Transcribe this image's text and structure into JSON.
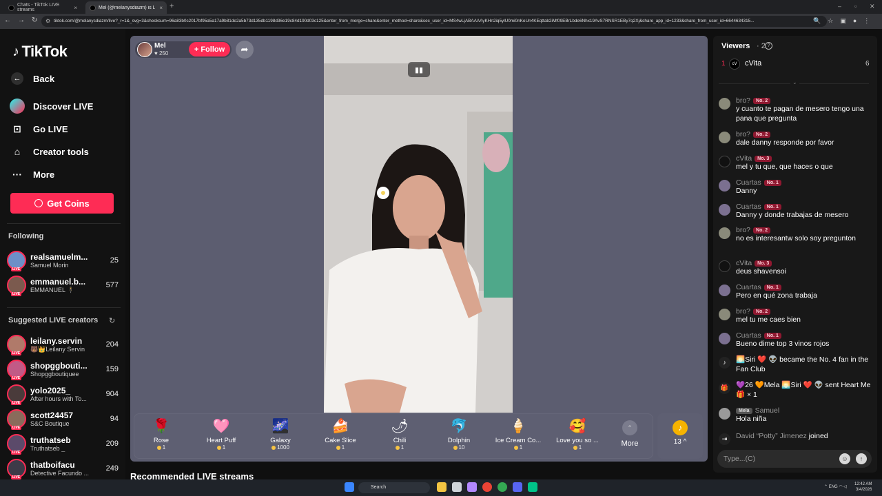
{
  "browser": {
    "tabs": [
      {
        "title": "Chats - TikTok LIVE streams",
        "active": false
      },
      {
        "title": "Mel (@melanysdiazm) is LIVE",
        "active": true
      }
    ],
    "url": "tiktok.com/@melanysdiazm/live?_r=1&_svg=3&checksum=96a83b0c2017bf95a5a17a9b81de2a5b73d135db1198d36e19c84d190d03c125&enter_from_merge=share&enter_method=share&sec_user_id=MS4wLjABAAAAyKHn2iq5ylU0mi0nKoUn4KEqttab2iMf09EBrLbde6Nhx19AvS7RNSR1EBy7q2Xj&share_app_id=1233&share_from_user_id=6644634315..."
  },
  "sidebar": {
    "logo": "TikTok",
    "nav": [
      {
        "label": "Back",
        "icon": "back-arrow-icon"
      },
      {
        "label": "Discover LIVE",
        "icon": "discover-live-icon"
      },
      {
        "label": "Go LIVE",
        "icon": "video-camera-icon"
      },
      {
        "label": "Creator tools",
        "icon": "lightbulb-icon"
      },
      {
        "label": "More",
        "icon": "more-dots-icon"
      }
    ],
    "get_coins": "Get Coins",
    "following_title": "Following",
    "following": [
      {
        "name": "realsamuelm...",
        "sub": "Samuel Morin",
        "count": "25",
        "color": "#6d8fc7"
      },
      {
        "name": "emmanuel.b...",
        "sub": "EMMANUEL 🕴",
        "count": "577",
        "color": "#7b5a4e"
      }
    ],
    "suggested_title": "Suggested LIVE creators",
    "suggested": [
      {
        "name": "leilany.servin",
        "sub": "🐻👑Leilany Servin",
        "count": "204",
        "color": "#b07a6a"
      },
      {
        "name": "shopggbouti...",
        "sub": "Shopggboutiquee",
        "count": "159",
        "color": "#c25a86"
      },
      {
        "name": "yolo2025_",
        "sub": "After hours with To...",
        "count": "904",
        "color": "#4a3b3b"
      },
      {
        "name": "scott24457",
        "sub": "S&C Boutique",
        "count": "94",
        "color": "#8a6b5b"
      },
      {
        "name": "truthatseb",
        "sub": "Truthatseb _",
        "count": "209",
        "color": "#5b4a6a"
      },
      {
        "name": "thatboifacu",
        "sub": "Detective Facundo ...",
        "count": "249",
        "color": "#3d3a48"
      }
    ]
  },
  "stream": {
    "host_name": "Mel",
    "host_likes": "250",
    "follow": "+ Follow",
    "gifts": [
      {
        "name": "Rose",
        "price": "1",
        "icon": "🌹"
      },
      {
        "name": "Heart Puff",
        "price": "1",
        "icon": "🩷"
      },
      {
        "name": "Galaxy",
        "price": "1000",
        "icon": "🌌"
      },
      {
        "name": "Cake Slice",
        "price": "1",
        "icon": "🍰"
      },
      {
        "name": "Chili",
        "price": "1",
        "icon": "🌶"
      },
      {
        "name": "Dolphin",
        "price": "10",
        "icon": "🐬"
      },
      {
        "name": "Ice Cream Co...",
        "price": "1",
        "icon": "🍦"
      },
      {
        "name": "Love you so ...",
        "price": "1",
        "icon": "🥰"
      }
    ],
    "more_label": "More",
    "coin_count": "13",
    "recommended": "Recommended LIVE streams"
  },
  "chat": {
    "viewers_title": "Viewers",
    "viewers_count": "· 2",
    "top_viewer": {
      "rank": "1",
      "name": "cVita",
      "score": "6"
    },
    "messages": [
      {
        "name": "bro?",
        "badge": "No. 2",
        "text": "y cuanto te pagan de mesero tengo una pana que pregunta",
        "avatar_color": "#8a8a7a"
      },
      {
        "name": "bro?",
        "badge": "No. 2",
        "text": "dale danny responde por favor",
        "avatar_color": "#8a8a7a"
      },
      {
        "name": "cVita",
        "badge": "No. 3",
        "text": "mel y tu que, que haces o que",
        "avatar_color": "#111111"
      },
      {
        "name": "Cuartas",
        "badge": "No. 1",
        "text": "Danny",
        "avatar_color": "#7b7090"
      },
      {
        "name": "Cuartas",
        "badge": "No. 1",
        "text": "Danny y donde trabajas de mesero",
        "avatar_color": "#7b7090"
      },
      {
        "name": "bro?",
        "badge": "No. 2",
        "text": "no es interesantw solo soy pregunton",
        "avatar_color": "#8a8a7a"
      },
      {
        "name": "cVita",
        "badge": "No. 3",
        "text": "deus shavensoi",
        "avatar_color": "#111111"
      },
      {
        "name": "Cuartas",
        "badge": "No. 1",
        "text": "Pero en qué zona trabaja",
        "avatar_color": "#7b7090"
      },
      {
        "name": "bro?",
        "badge": "No. 2",
        "text": "mel tu me caes bien",
        "avatar_color": "#8a8a7a"
      },
      {
        "name": "Cuartas",
        "badge": "No. 1",
        "text": "Bueno dime top 3 vinos rojos",
        "avatar_color": "#7b7090"
      }
    ],
    "system1": "🌅Siri ❤️ 👽 became the No. 4 fan in the Fan Club",
    "system2": "💜26 🧡Mela 🌅Siri ❤️ 👽 sent Heart Me 🎁 × 1",
    "last_name": "Samuel",
    "last_badge": "Mela",
    "last_text": "Hola niña",
    "joined_name": "David “Potty” Jimenez",
    "joined_word": "joined",
    "input_placeholder": "Type...(C)"
  },
  "taskbar": {
    "search": "Search",
    "lang": "ENG",
    "time": "12:42 AM",
    "date": "3/4/2026"
  }
}
